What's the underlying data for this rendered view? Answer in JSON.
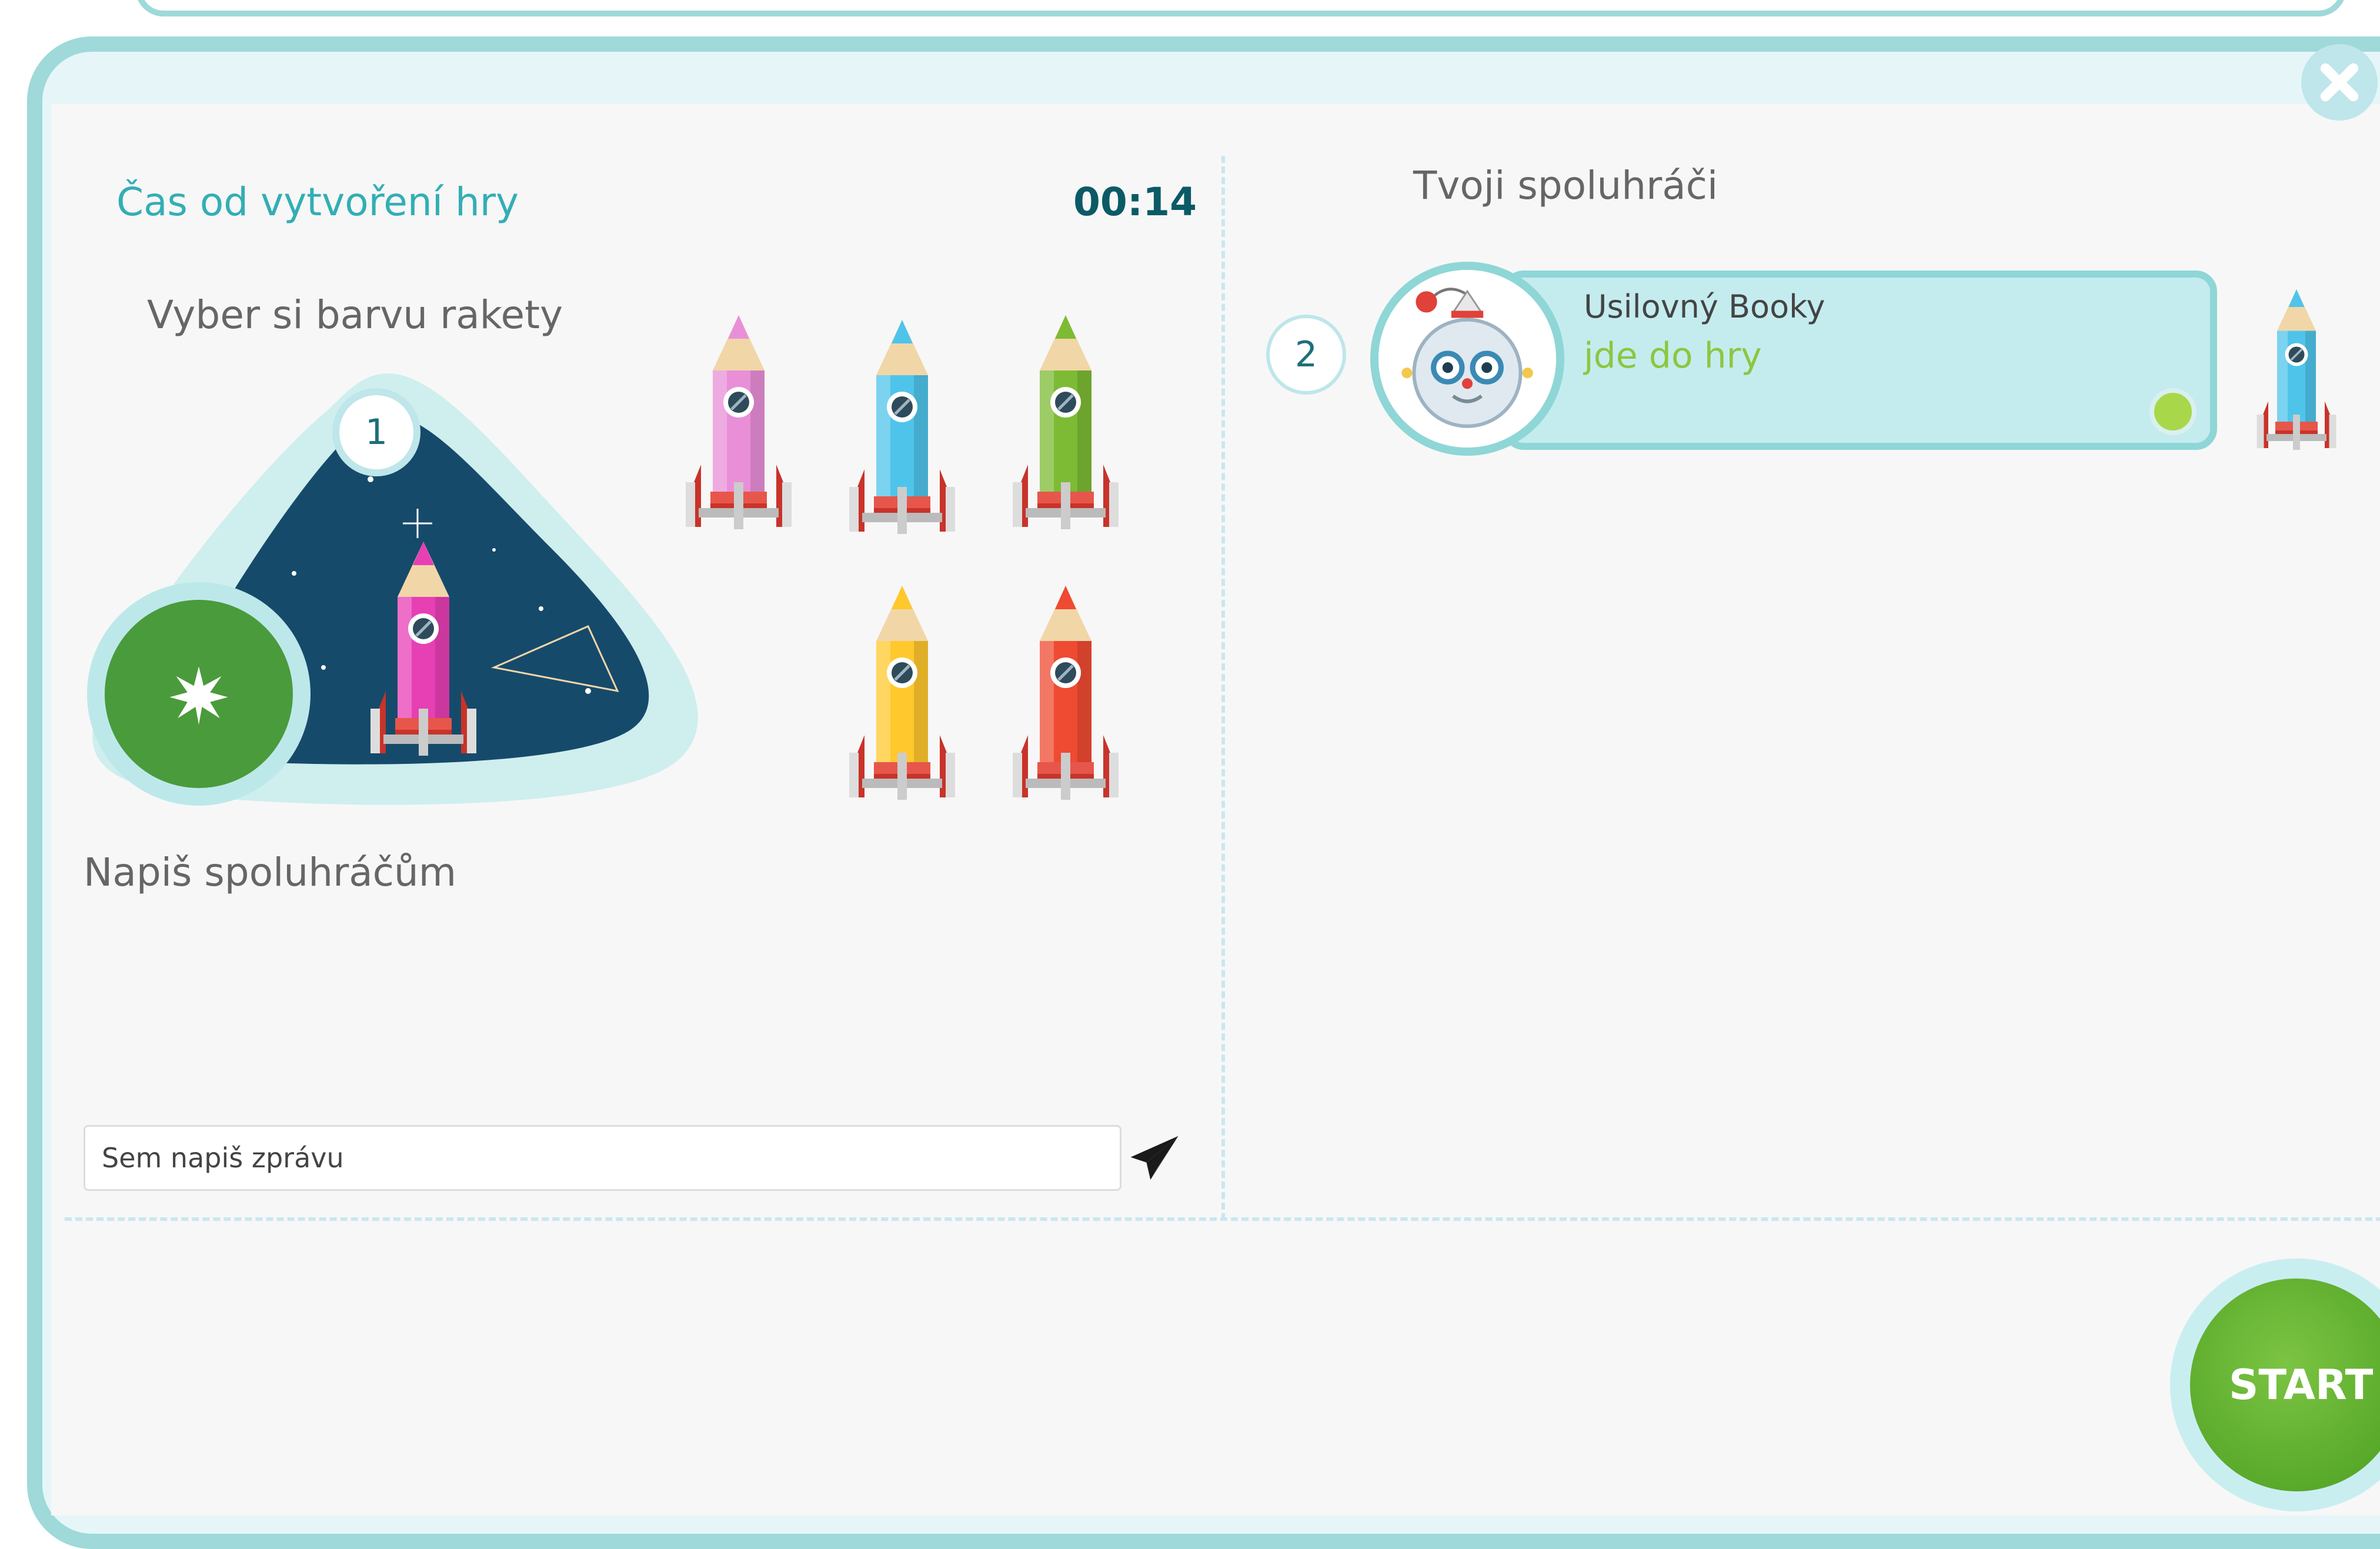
{
  "header": {
    "close_icon": "close-icon"
  },
  "left": {
    "timer_label": "Čas od vytvoření hry",
    "timer_value": "00:14",
    "rocket_picker_label": "Vyber si barvu rakety",
    "player_slot_number": "1",
    "rocket_colors": [
      {
        "name": "pink",
        "color": "#e98fd8"
      },
      {
        "name": "blue",
        "color": "#4fc4ea"
      },
      {
        "name": "green",
        "color": "#7dbb34"
      },
      {
        "name": "yellow",
        "color": "#ffc82d"
      },
      {
        "name": "red",
        "color": "#ef4a32"
      }
    ],
    "selected_rocket": {
      "name": "magenta",
      "color": "#e73fb4"
    },
    "chat_label": "Napiš spoluhráčům",
    "chat_placeholder": "Sem napiš zprávu",
    "send_icon": "paper-plane-icon"
  },
  "right": {
    "mates_label": "Tvoji spoluhráči",
    "players": [
      {
        "number": "2",
        "name": "Usilovný Booky",
        "status": "jde do hry",
        "rocket_color": "#4fc4ea",
        "online_color": "#a8d84a"
      }
    ]
  },
  "footer": {
    "start_label": "START"
  },
  "colors": {
    "frame": "#9fd9d9",
    "accent": "#33aeb5",
    "start_green": "#5aaa2b",
    "status_green": "#8ec63f"
  }
}
